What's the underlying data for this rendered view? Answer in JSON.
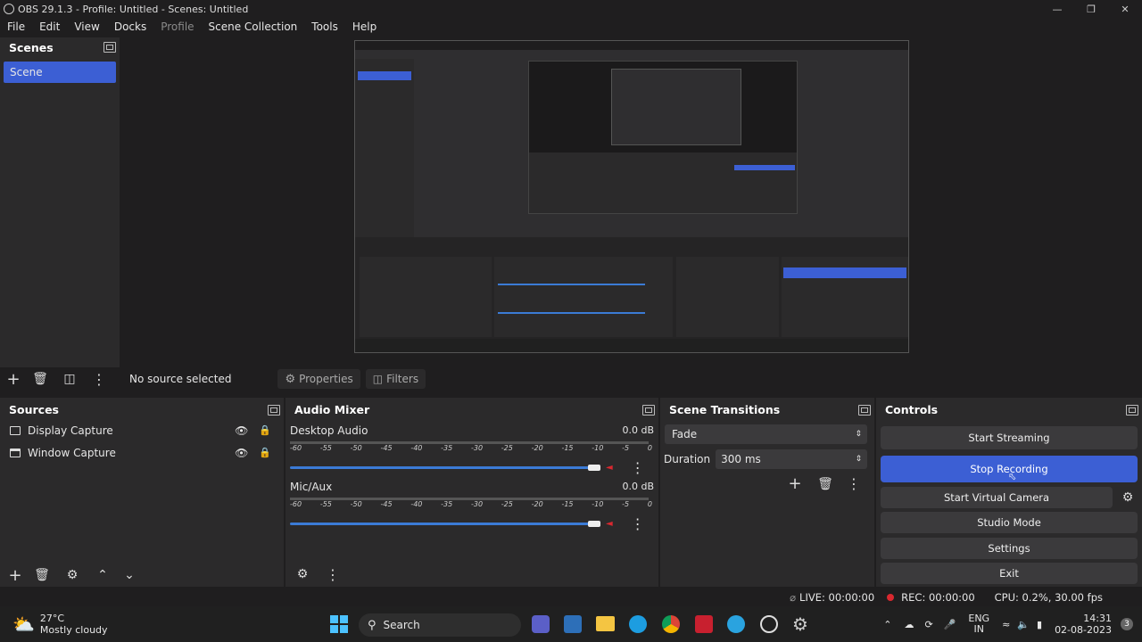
{
  "window": {
    "title": "OBS 29.1.3 - Profile: Untitled - Scenes: Untitled"
  },
  "menu": [
    "File",
    "Edit",
    "View",
    "Docks",
    "Profile",
    "Scene Collection",
    "Tools",
    "Help"
  ],
  "scenes": {
    "title": "Scenes",
    "items": [
      "Scene"
    ]
  },
  "source_toolbar": {
    "status": "No source selected",
    "properties": "Properties",
    "filters": "Filters"
  },
  "sources": {
    "title": "Sources",
    "items": [
      "Display Capture",
      "Window Capture"
    ]
  },
  "mixer": {
    "title": "Audio Mixer",
    "channels": [
      {
        "name": "Desktop Audio",
        "db": "0.0 dB"
      },
      {
        "name": "Mic/Aux",
        "db": "0.0 dB"
      }
    ],
    "ticks": [
      "-60",
      "-55",
      "-50",
      "-45",
      "-40",
      "-35",
      "-30",
      "-25",
      "-20",
      "-15",
      "-10",
      "-5",
      "0"
    ]
  },
  "transitions": {
    "title": "Scene Transitions",
    "selected": "Fade",
    "duration_label": "Duration",
    "duration_value": "300 ms"
  },
  "controls": {
    "title": "Controls",
    "start_streaming": "Start Streaming",
    "stop_recording": "Stop Recording",
    "start_virtual_camera": "Start Virtual Camera",
    "studio_mode": "Studio Mode",
    "settings": "Settings",
    "exit": "Exit"
  },
  "statusbar": {
    "live": "LIVE: 00:00:00",
    "rec": "REC: 00:00:00",
    "cpu": "CPU: 0.2%, 30.00 fps"
  },
  "taskbar": {
    "weather_temp": "27°C",
    "weather_desc": "Mostly cloudy",
    "search": "Search",
    "lang1": "ENG",
    "lang2": "IN",
    "time": "14:31",
    "date": "02-08-2023",
    "notif_count": "3"
  },
  "colors": {
    "accent": "#3c5fd4",
    "rec": "#d9282f",
    "bg": "#1f1e1f"
  }
}
